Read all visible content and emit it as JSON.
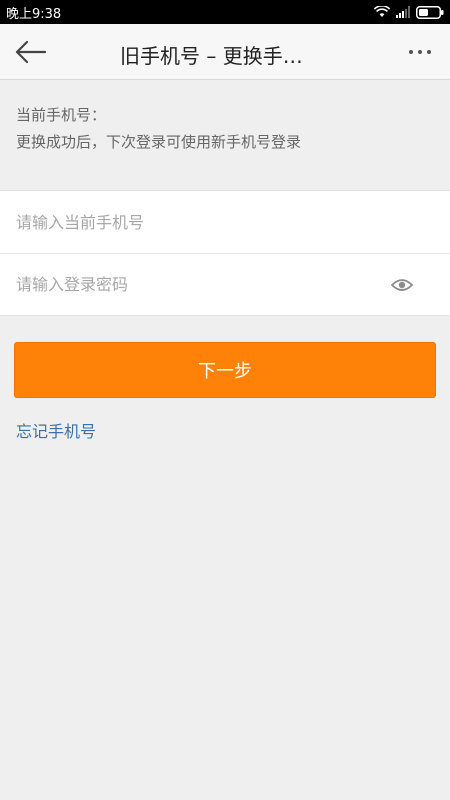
{
  "status_bar": {
    "time": "晚上9:38"
  },
  "nav": {
    "title": "旧手机号 – 更换手…"
  },
  "info": {
    "line1": "当前手机号：",
    "line2": "更换成功后，下次登录可使用新手机号登录"
  },
  "form": {
    "phone_placeholder": "请输入当前手机号",
    "phone_value": "",
    "password_placeholder": "请输入登录密码",
    "password_value": ""
  },
  "next_button_label": "下一步",
  "forgot_link_label": "忘记手机号",
  "colors": {
    "accent": "#ff8208",
    "link": "#3d6fa5",
    "background": "#efefef"
  },
  "icons": {
    "back": "arrow-left-icon",
    "more": "more-dots-icon",
    "eye": "eye-icon",
    "wifi": "wifi-icon",
    "signal": "signal-icon",
    "battery": "battery-icon"
  }
}
